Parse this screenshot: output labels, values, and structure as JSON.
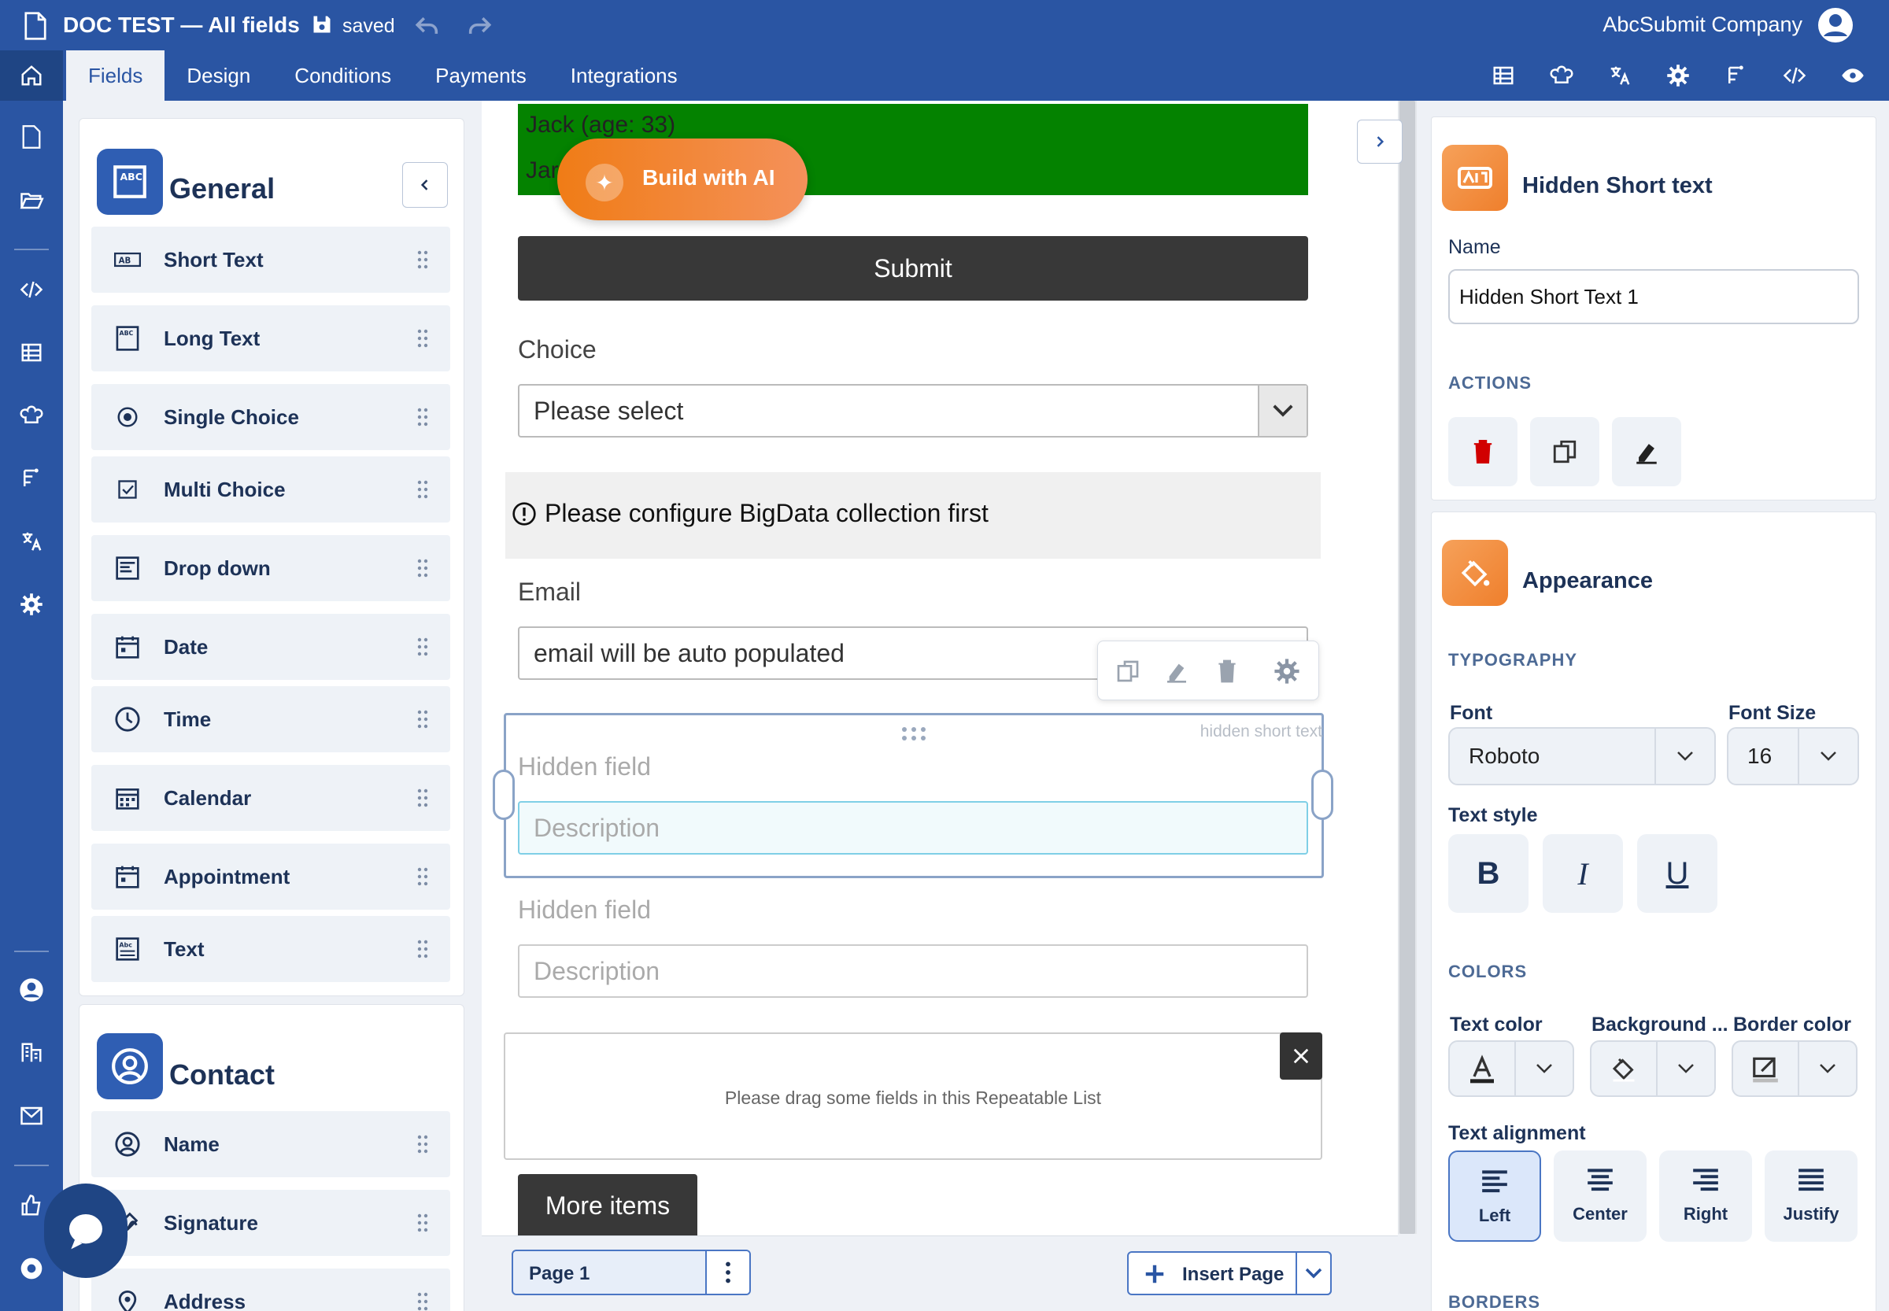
{
  "app": {
    "doc_title": "DOC TEST — All fields",
    "save_status": "saved",
    "company": "AbcSubmit Company",
    "tabs": [
      "Fields",
      "Design",
      "Conditions",
      "Payments",
      "Integrations"
    ],
    "active_tab": "Fields",
    "accent_color": "#2a55a3"
  },
  "toolbar_icons": [
    "table-icon",
    "chef-hat-icon",
    "translate-icon",
    "gear-icon",
    "flow-icon",
    "code-icon",
    "eye-icon"
  ],
  "rail_icons": [
    "document-icon",
    "folder-open-icon",
    "code-icon",
    "table-icon",
    "chef-hat-icon",
    "flow-icon",
    "translate-icon",
    "gear-icon",
    "user-circle-icon",
    "building-icon",
    "mail-icon",
    "thumb-up-icon",
    "lifebuoy-icon"
  ],
  "palette": {
    "general": {
      "title": "General",
      "items": [
        {
          "label": "Short Text",
          "icon": "short-text-icon"
        },
        {
          "label": "Long Text",
          "icon": "long-text-icon"
        },
        {
          "label": "Single Choice",
          "icon": "radio-icon"
        },
        {
          "label": "Multi Choice",
          "icon": "checkbox-icon"
        },
        {
          "label": "Drop down",
          "icon": "dropdown-icon"
        },
        {
          "label": "Date",
          "icon": "date-icon"
        },
        {
          "label": "Time",
          "icon": "clock-icon"
        },
        {
          "label": "Calendar",
          "icon": "calendar-icon"
        },
        {
          "label": "Appointment",
          "icon": "appointment-icon"
        },
        {
          "label": "Text",
          "icon": "text-block-icon"
        }
      ]
    },
    "contact": {
      "title": "Contact",
      "items": [
        {
          "label": "Name",
          "icon": "person-icon"
        },
        {
          "label": "Signature",
          "icon": "signature-icon"
        },
        {
          "label": "Address",
          "icon": "location-pin-icon"
        }
      ]
    }
  },
  "canvas": {
    "green_line1": "Jack (age: 33)",
    "green_line2": "Jar",
    "ai_button": "Build with AI",
    "submit_label": "Submit",
    "choice_label": "Choice",
    "choice_value": "Please select",
    "bigdata_warning": "Please configure BigData collection first",
    "email_label": "Email",
    "email_value": "email will be auto populated",
    "hidden_tag": "hidden short text",
    "hidden1_label": "Hidden field",
    "hidden1_placeholder": "Description",
    "hidden2_label": "Hidden field",
    "hidden2_placeholder": "Description",
    "repeatable_placeholder": "Please drag some fields in this Repeatable List",
    "more_items": "More items",
    "page_label": "Page 1",
    "insert_page": "Insert Page"
  },
  "properties": {
    "field_title": "Hidden Short text",
    "name_label": "Name",
    "name_value": "Hidden Short Text 1",
    "actions_heading": "ACTIONS",
    "appearance_title": "Appearance",
    "typography_heading": "TYPOGRAPHY",
    "font_label": "Font",
    "font_value": "Roboto",
    "font_size_label": "Font Size",
    "font_size_value": "16",
    "text_style_label": "Text style",
    "style_buttons": [
      "B",
      "I",
      "U"
    ],
    "colors_heading": "COLORS",
    "text_color_label": "Text color",
    "background_label": "Background ...",
    "border_color_label": "Border color",
    "text_alignment_label": "Text alignment",
    "alignments": [
      "Left",
      "Center",
      "Right",
      "Justify"
    ],
    "active_alignment": "Left",
    "borders_heading": "BORDERS"
  }
}
